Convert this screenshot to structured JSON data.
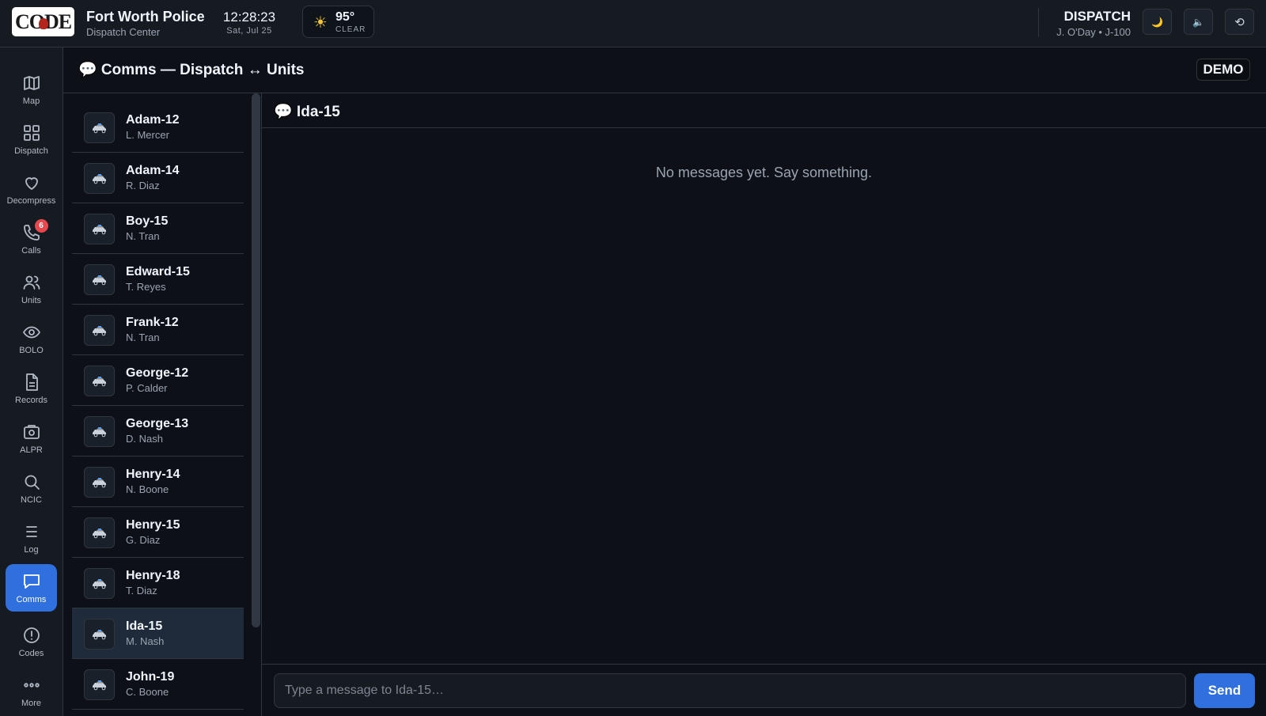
{
  "header": {
    "logo_text": "CODE",
    "org_name": "Fort Worth Police",
    "org_sub": "Dispatch Center",
    "time": "12:28:23",
    "date": "Sat, Jul 25",
    "weather": {
      "icon": "sun-icon",
      "temp": "95°",
      "condition": "CLEAR"
    },
    "role_title": "DISPATCH",
    "role_user": "J. O'Day • J-100",
    "buttons": [
      {
        "name": "theme-toggle",
        "icon": "moon-icon",
        "glyph": "🌙"
      },
      {
        "name": "sound-toggle",
        "icon": "speaker-muted-icon",
        "glyph": "🔈"
      },
      {
        "name": "reset",
        "icon": "reset-icon",
        "glyph": "⟲"
      }
    ]
  },
  "nav": {
    "items": [
      {
        "label": "Map",
        "icon": "map-icon"
      },
      {
        "label": "Dispatch",
        "icon": "grid-icon"
      },
      {
        "label": "Decompress",
        "icon": "heart-icon"
      },
      {
        "label": "Calls",
        "icon": "phone-icon",
        "badge": "6"
      },
      {
        "label": "Units",
        "icon": "users-icon"
      },
      {
        "label": "BOLO",
        "icon": "eye-icon"
      },
      {
        "label": "Records",
        "icon": "file-icon"
      },
      {
        "label": "ALPR",
        "icon": "camera-icon"
      },
      {
        "label": "NCIC",
        "icon": "search-icon"
      },
      {
        "label": "Log",
        "icon": "list-icon"
      },
      {
        "label": "Comms",
        "icon": "message-icon",
        "active": true
      },
      {
        "label": "Codes",
        "icon": "info-icon"
      },
      {
        "label": "More",
        "icon": "more-icon"
      }
    ]
  },
  "page": {
    "title": "💬 Comms — Dispatch ↔ Units",
    "demo_badge": "DEMO"
  },
  "units": [
    {
      "name": "Adam-12",
      "officer": "L. Mercer"
    },
    {
      "name": "Adam-14",
      "officer": "R. Diaz"
    },
    {
      "name": "Boy-15",
      "officer": "N. Tran"
    },
    {
      "name": "Edward-15",
      "officer": "T. Reyes"
    },
    {
      "name": "Frank-12",
      "officer": "N. Tran"
    },
    {
      "name": "George-12",
      "officer": "P. Calder"
    },
    {
      "name": "George-13",
      "officer": "D. Nash"
    },
    {
      "name": "Henry-14",
      "officer": "N. Boone"
    },
    {
      "name": "Henry-15",
      "officer": "G. Diaz"
    },
    {
      "name": "Henry-18",
      "officer": "T. Diaz"
    },
    {
      "name": "Ida-15",
      "officer": "M. Nash",
      "selected": true
    },
    {
      "name": "John-19",
      "officer": "C. Boone"
    }
  ],
  "conversation": {
    "title": "💬 Ida-15",
    "empty_text": "No messages yet. Say something.",
    "input_value": "",
    "input_placeholder": "Type a message to Ida-15…",
    "send_label": "Send"
  },
  "colors": {
    "background": "#0d1117",
    "panel": "#161b22",
    "accent": "#2f6fde",
    "badge": "#e5484d",
    "selected_row": "#1f2a3a"
  }
}
